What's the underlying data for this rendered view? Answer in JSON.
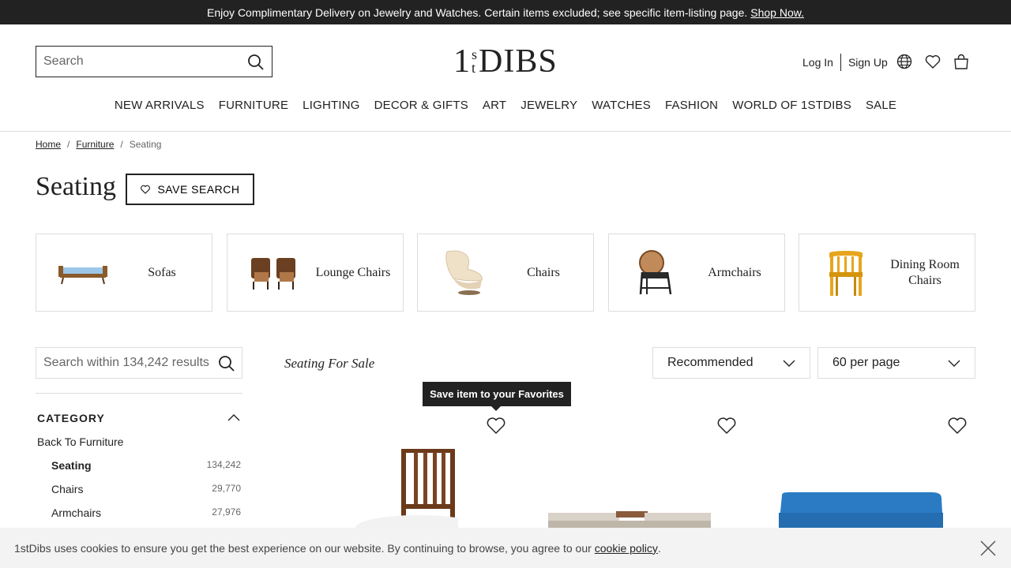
{
  "promo": {
    "text": "Enjoy Complimentary Delivery on Jewelry and Watches. Certain items excluded; see specific item-listing page.",
    "link": "Shop Now."
  },
  "header": {
    "search_placeholder": "Search",
    "logo_one": "1",
    "logo_s": "s",
    "logo_t": "t",
    "logo_dibs": "DIBS",
    "login": "Log In",
    "signup": "Sign Up"
  },
  "nav": [
    "NEW ARRIVALS",
    "FURNITURE",
    "LIGHTING",
    "DECOR & GIFTS",
    "ART",
    "JEWELRY",
    "WATCHES",
    "FASHION",
    "WORLD OF 1STDIBS",
    "SALE"
  ],
  "breadcrumb": {
    "home": "Home",
    "furniture": "Furniture",
    "current": "Seating",
    "separator": "/"
  },
  "page": {
    "title": "Seating",
    "save_search": "SAVE SEARCH"
  },
  "categories": [
    {
      "label": "Sofas"
    },
    {
      "label": "Lounge Chairs"
    },
    {
      "label": "Chairs"
    },
    {
      "label": "Armchairs"
    },
    {
      "label": "Dining Room Chairs"
    }
  ],
  "filters": {
    "search_placeholder": "Search within 134,242 results",
    "category_heading": "CATEGORY",
    "back": "Back To Furniture",
    "items": [
      {
        "label": "Seating",
        "count": "134,242",
        "selected": true
      },
      {
        "label": "Chairs",
        "count": "29,770",
        "selected": false
      },
      {
        "label": "Armchairs",
        "count": "27,976",
        "selected": false
      }
    ]
  },
  "results": {
    "heading": "Seating For Sale",
    "sort": "Recommended",
    "per_page": "60 per page",
    "tooltip": "Save item to your Favorites"
  },
  "cookie": {
    "text": "1stDibs uses cookies to ensure you get the best experience on our website. By continuing to browse, you agree to our",
    "link": "cookie policy",
    "end": "."
  },
  "colors": {
    "dark": "#222222",
    "border": "#dddddd",
    "cookie_bg": "#f3f3f3",
    "blue_sofa": "#2a7bc4"
  }
}
